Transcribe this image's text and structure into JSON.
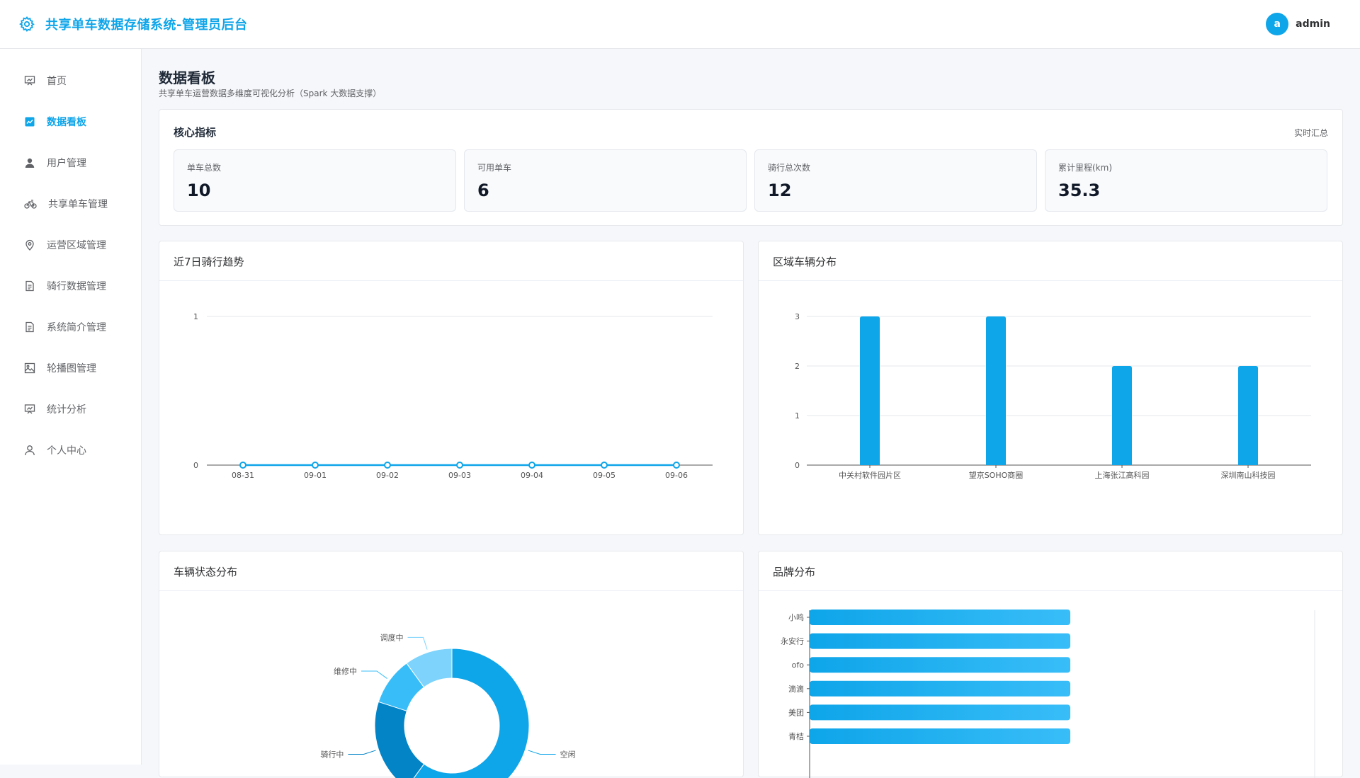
{
  "app": {
    "title": "共享单车数据存储系统-管理员后台"
  },
  "user": {
    "avatar_letter": "a",
    "name": "admin"
  },
  "sidebar": {
    "items": [
      {
        "label": "首页",
        "icon": "presentation-icon",
        "active": false
      },
      {
        "label": "数据看板",
        "icon": "chart-icon",
        "active": true
      },
      {
        "label": "用户管理",
        "icon": "user-icon",
        "active": false
      },
      {
        "label": "共享单车管理",
        "icon": "bicycle-icon",
        "active": false
      },
      {
        "label": "运营区域管理",
        "icon": "location-icon",
        "active": false
      },
      {
        "label": "骑行数据管理",
        "icon": "document-icon",
        "active": false
      },
      {
        "label": "系统简介管理",
        "icon": "document-icon",
        "active": false
      },
      {
        "label": "轮播图管理",
        "icon": "image-icon",
        "active": false
      },
      {
        "label": "统计分析",
        "icon": "presentation-icon",
        "active": false
      },
      {
        "label": "个人中心",
        "icon": "user-outline-icon",
        "active": false
      }
    ]
  },
  "page": {
    "title": "数据看板",
    "subtitle": "共享单车运营数据多维度可视化分析（Spark 大数据支撑）"
  },
  "kpi": {
    "title": "核心指标",
    "extra": "实时汇总",
    "items": [
      {
        "label": "单车总数",
        "value": "10"
      },
      {
        "label": "可用单车",
        "value": "6"
      },
      {
        "label": "骑行总次数",
        "value": "12"
      },
      {
        "label": "累计里程(km)",
        "value": "35.3"
      }
    ]
  },
  "cards": {
    "trend": "近7日骑行趋势",
    "region": "区域车辆分布",
    "status": "车辆状态分布",
    "brand": "品牌分布"
  },
  "colors": {
    "accent": "#0ea5e9",
    "accent_light": "#38bdf8",
    "accent_dark": "#0284c7",
    "accent_pale": "#7dd3fc"
  },
  "chart_data": [
    {
      "type": "line",
      "x": [
        "08-31",
        "09-01",
        "09-02",
        "09-03",
        "09-04",
        "09-05",
        "09-06"
      ],
      "series": [
        {
          "values": [
            0,
            0,
            0,
            0,
            0,
            0,
            0
          ]
        }
      ],
      "ylim": [
        0,
        1
      ],
      "yticks": [
        "0",
        "1"
      ],
      "grid": true
    },
    {
      "type": "bar",
      "categories": [
        "中关村软件园片区",
        "望京SOHO商圈",
        "上海张江高科园",
        "深圳南山科技园"
      ],
      "values": [
        3,
        3,
        2,
        2
      ],
      "ylim": [
        0,
        3
      ],
      "yticks": [
        "0",
        "1",
        "2",
        "3"
      ],
      "grid": true
    },
    {
      "type": "pie",
      "labels": [
        "空闲",
        "骑行中",
        "维修中",
        "调度中"
      ],
      "values": [
        6,
        2,
        1,
        1
      ],
      "colors": [
        "#0ea5e9",
        "#0284c7",
        "#38bdf8",
        "#7dd3fc"
      ]
    },
    {
      "type": "bar",
      "orientation": "horizontal",
      "categories": [
        "小鸣",
        "永安行",
        "ofo",
        "滴滴",
        "美团",
        "青桔"
      ],
      "values": [
        1,
        1,
        1,
        1,
        1,
        1
      ]
    }
  ]
}
